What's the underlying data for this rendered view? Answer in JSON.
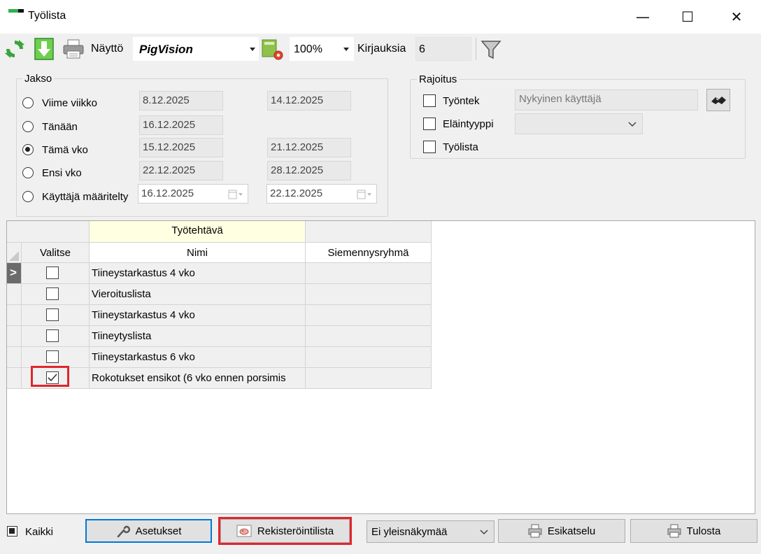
{
  "window": {
    "title": "Työlista",
    "minimize": "—",
    "maximize": "☐",
    "close": "✕"
  },
  "toolbar": {
    "display_label": "Näyttö",
    "display_value": "PigVision",
    "zoom_value": "100%",
    "records_label": "Kirjauksia",
    "records_value": "6"
  },
  "period": {
    "title": "Jakso",
    "options": [
      {
        "label": "Viime viikko",
        "from": "8.12.2025",
        "to": "14.12.2025",
        "selected": false
      },
      {
        "label": "Tänään",
        "from": "16.12.2025",
        "to": "",
        "selected": false
      },
      {
        "label": "Tämä vko",
        "from": "15.12.2025",
        "to": "21.12.2025",
        "selected": true
      },
      {
        "label": "Ensi vko",
        "from": "22.12.2025",
        "to": "28.12.2025",
        "selected": false
      },
      {
        "label": "Käyttäjä määritelty",
        "from": "16.12.2025",
        "to": "22.12.2025",
        "selected": false
      }
    ]
  },
  "limit": {
    "title": "Rajoitus",
    "worker_label": "Työntek",
    "worker_value": "Nykyinen käyttäjä",
    "animal_type_label": "Eläintyyppi",
    "animal_type_value": "",
    "worklist_label": "Työlista"
  },
  "grid": {
    "group_header": "Työtehtävä",
    "columns": {
      "select": "Valitse",
      "name": "Nimi",
      "group": "Siemennysryhmä"
    },
    "current_row_marker": ">",
    "rows": [
      {
        "name": "Tiineystarkastus 4 vko",
        "group": "",
        "checked": false
      },
      {
        "name": "Vieroituslista",
        "group": "",
        "checked": false
      },
      {
        "name": "Tiineystarkastus 4 vko",
        "group": "",
        "checked": false
      },
      {
        "name": "Tiineytyslista",
        "group": "",
        "checked": false
      },
      {
        "name": "Tiineystarkastus 6 vko",
        "group": "",
        "checked": false
      },
      {
        "name": "Rokotukset ensikot (6 vko ennen porsimis",
        "group": "",
        "checked": true
      }
    ]
  },
  "footer": {
    "all_label": "Kaikki",
    "settings_label": "Asetukset",
    "register_label": "Rekisteröintilista",
    "view_value": "Ei yleisnäkymää",
    "preview_label": "Esikatselu",
    "print_label": "Tulosta"
  },
  "colors": {
    "highlight_red": "#e0262d",
    "group_header_bg": "#ffffe1",
    "accent_blue": "#0078d7"
  }
}
